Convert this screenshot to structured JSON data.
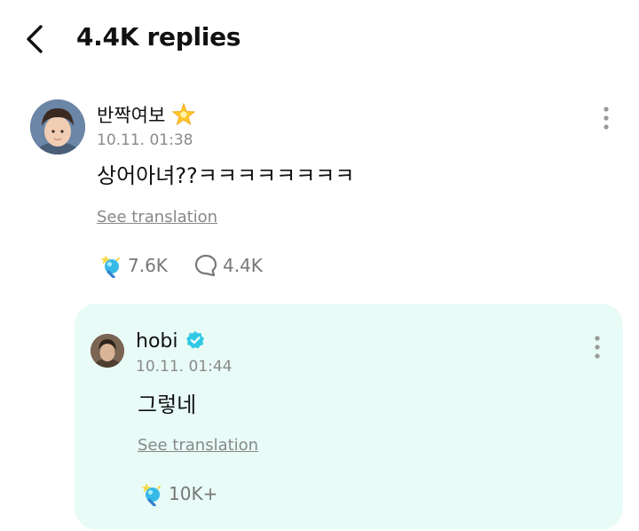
{
  "header": {
    "back_icon": "chevron-left-icon",
    "title": "4.4K replies"
  },
  "comment": {
    "username": "반짝여보",
    "username_emoji": "glowing-star-icon",
    "timestamp": "10.11. 01:38",
    "text": "상어아녀??ㅋㅋㅋㅋㅋㅋㅋㅋ",
    "translate_label": "See translation",
    "likes": "7.6K",
    "replies": "4.4K"
  },
  "reply": {
    "username": "hobi",
    "verified_icon": "verified-badge-icon",
    "timestamp": "10.11. 01:44",
    "text": "그렇네",
    "translate_label": "See translation",
    "likes": "10K+"
  },
  "colors": {
    "reply_bg": "#e8fbf7",
    "meta_gray": "#8a8a8a",
    "verified": "#32c8e6",
    "like_icon": "#36b9e6"
  }
}
